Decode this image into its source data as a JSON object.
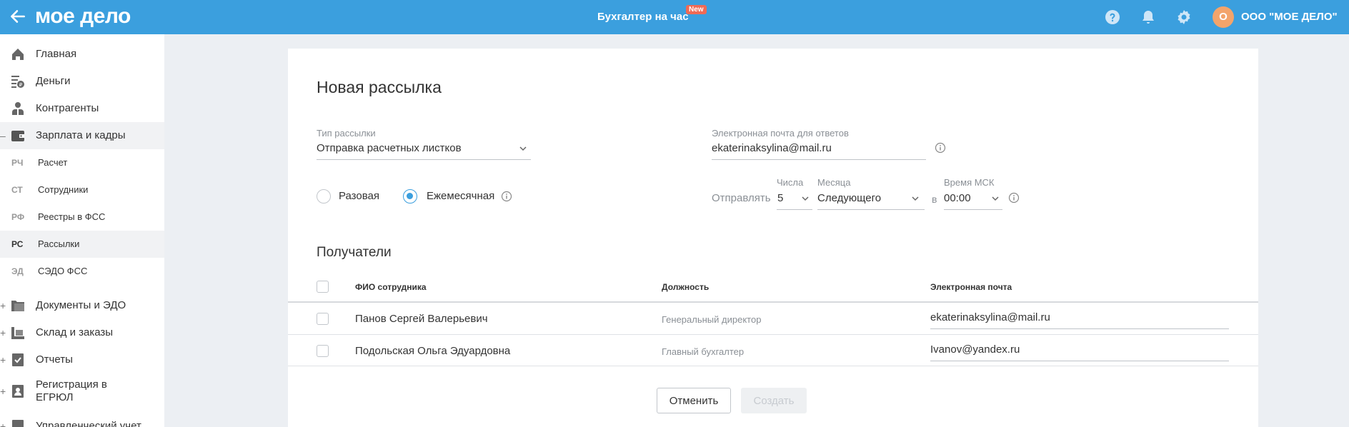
{
  "topbar": {
    "logo": "мое дело",
    "center_title": "Бухгалтер на час",
    "new_badge": "New",
    "avatar_letter": "О",
    "company": "ООО \"МОЕ ДЕЛО\"",
    "icons": [
      "back-arrow-icon",
      "help-icon",
      "bell-icon",
      "gear-icon"
    ],
    "color": "#3b9fde"
  },
  "sidebar": {
    "items": [
      {
        "label": "Главная",
        "icon": "home-icon"
      },
      {
        "label": "Деньги",
        "icon": "money-icon"
      },
      {
        "label": "Контрагенты",
        "icon": "contractors-icon"
      },
      {
        "label": "Зарплата и кадры",
        "icon": "wallet-icon",
        "prefix": "–"
      },
      {
        "label": "Документы и ЭДО",
        "icon": "documents-icon",
        "prefix": "+"
      },
      {
        "label": "Склад и заказы",
        "icon": "warehouse-icon",
        "prefix": "+"
      },
      {
        "label": "Отчеты",
        "icon": "reports-icon",
        "prefix": "+"
      },
      {
        "label": "Регистрация в ЕГРЮЛ",
        "icon": "registration-icon",
        "prefix": "+"
      },
      {
        "label": "Управленческий учет",
        "icon": "management-icon",
        "prefix": "+"
      }
    ],
    "subitems": [
      {
        "code": "РЧ",
        "label": "Расчет"
      },
      {
        "code": "СТ",
        "label": "Сотрудники"
      },
      {
        "code": "РФ",
        "label": "Реестры в ФСС"
      },
      {
        "code": "РС",
        "label": "Рассылки"
      },
      {
        "code": "ЭД",
        "label": "СЭДО ФСС"
      }
    ]
  },
  "form": {
    "title": "Новая рассылка",
    "type_label": "Тип рассылки",
    "type_value": "Отправка расчетных листков",
    "email_label": "Электронная почта для ответов",
    "email_value": "ekaterinaksylina@mail.ru",
    "radio_once": "Разовая",
    "radio_monthly": "Ежемесячная",
    "send_label": "Отправлять",
    "day_label": "Числа",
    "day_value": "5",
    "month_label": "Месяца",
    "month_value": "Следующего",
    "in_label": "в",
    "time_label": "Время МСК",
    "time_value": "00:00"
  },
  "recipients": {
    "title": "Получатели",
    "columns": [
      "ФИО сотрудника",
      "Должность",
      "Электронная почта"
    ],
    "rows": [
      {
        "name": "Панов Сергей Валерьевич",
        "position": "Генеральный директор",
        "email": "ekaterinaksylina@mail.ru"
      },
      {
        "name": "Подольская Ольга Эдуардовна",
        "position": "Главный бухгалтер",
        "email": "Ivanov@yandex.ru"
      }
    ]
  },
  "buttons": {
    "cancel": "Отменить",
    "create": "Создать"
  }
}
